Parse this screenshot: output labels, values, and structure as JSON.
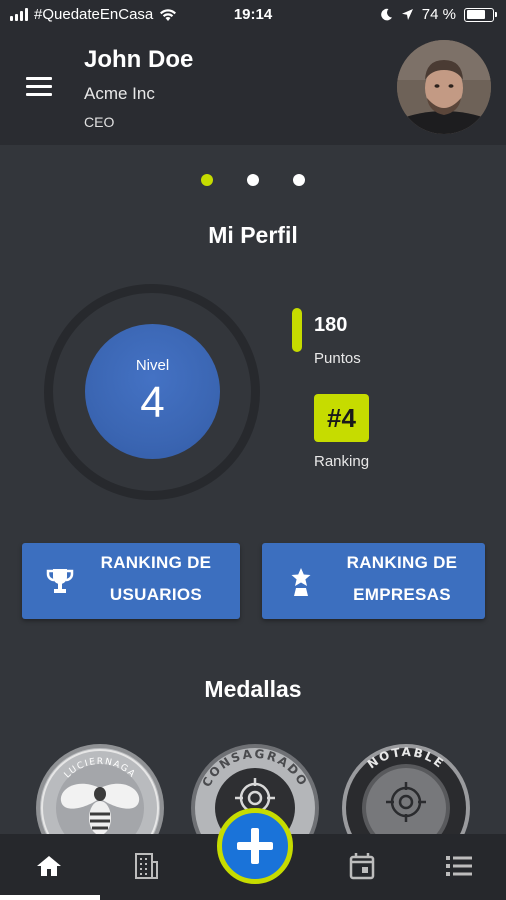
{
  "status_bar": {
    "carrier": "#QuedateEnCasa",
    "time": "19:14",
    "battery_percent": "74 %",
    "battery_level": 0.74
  },
  "header": {
    "name": "John Doe",
    "company": "Acme Inc",
    "role": "CEO"
  },
  "pager": {
    "count": 3,
    "active_index": 0
  },
  "profile": {
    "title": "Mi Perfil",
    "level_label": "Nivel",
    "level_value": "4",
    "points_value": "180",
    "points_label": "Puntos",
    "ranking_value": "#4",
    "ranking_label": "Ranking"
  },
  "buttons": {
    "users_ranking": [
      "RANKING DE",
      "USUARIOS"
    ],
    "companies_ranking": [
      "RANKING DE",
      "EMPRESAS"
    ]
  },
  "medals": {
    "title": "Medallas",
    "items": [
      {
        "name": "LUCIERNAGA",
        "icon": "firefly-icon"
      },
      {
        "name": "CONSAGRADO",
        "icon": "target-icon"
      },
      {
        "name": "NOTABLE",
        "icon": "target-icon"
      }
    ]
  },
  "nav": {
    "items": [
      "home-icon",
      "building-icon",
      "add-icon",
      "calendar-icon",
      "list-icon"
    ],
    "active": "home-icon"
  },
  "colors": {
    "accent": "#c6dc00",
    "primary_blue": "#3c6fbf",
    "background": "#33363b",
    "header": "#2a2c31"
  }
}
